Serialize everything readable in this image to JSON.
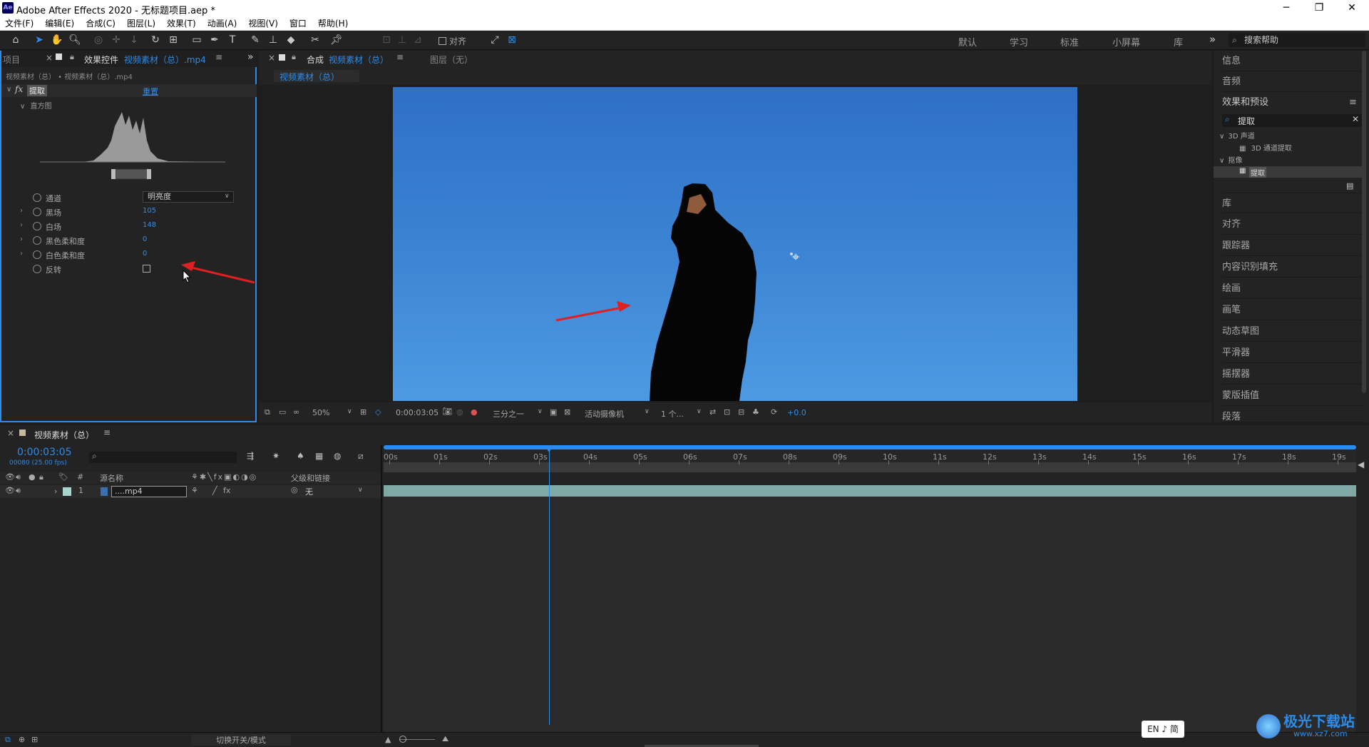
{
  "app": {
    "title": "Adobe After Effects 2020 - 无标题项目.aep *",
    "logo": "Ae"
  },
  "window_controls": {
    "minimize": "─",
    "restore": "❐",
    "close": "✕"
  },
  "menu": [
    "文件(F)",
    "编辑(E)",
    "合成(C)",
    "图层(L)",
    "效果(T)",
    "动画(A)",
    "视图(V)",
    "窗口",
    "帮助(H)"
  ],
  "toolbar": {
    "align_label": "对齐",
    "workspaces": [
      "默认",
      "学习",
      "标准",
      "小屏幕",
      "库"
    ],
    "more": "»",
    "search_help": "搜索帮助"
  },
  "left_panel": {
    "project_tab": "项目",
    "tab_prefix": "效果控件",
    "tab_source": "视频素材（总）.mp4",
    "breadcrumb": "视频素材（总） • 视频素材（总）.mp4",
    "effect_name": "提取",
    "reset": "重置",
    "histogram_label": "直方图",
    "properties": [
      {
        "label": "通道",
        "value": "明亮度",
        "type": "select"
      },
      {
        "label": "黑场",
        "value": "105",
        "type": "num"
      },
      {
        "label": "白场",
        "value": "148",
        "type": "num"
      },
      {
        "label": "黑色柔和度",
        "value": "0",
        "type": "num"
      },
      {
        "label": "白色柔和度",
        "value": "0",
        "type": "num"
      },
      {
        "label": "反转",
        "value": "",
        "type": "checkbox"
      }
    ]
  },
  "comp_panel": {
    "tab_prefix": "合成",
    "tab_name": "视频素材（总）",
    "layer_tab": "图层（无）",
    "sub_tab": "视频素材（总）",
    "zoom": "50%",
    "timecode": "0:00:03:05",
    "resolution": "三分之一",
    "camera": "活动摄像机",
    "views": "1 个...",
    "exposure": "+0.0"
  },
  "right_panel": {
    "info": "信息",
    "audio": "音频",
    "effects_presets": "效果和预设",
    "search_value": "提取",
    "tree": [
      {
        "label": "3D 声道",
        "level": 0
      },
      {
        "label": "3D 通道提取",
        "level": 1
      },
      {
        "label": "抠像",
        "level": 0
      },
      {
        "label": "提取",
        "level": 1,
        "selected": true
      }
    ],
    "items": [
      "库",
      "对齐",
      "跟踪器",
      "内容识别填充",
      "绘画",
      "画笔",
      "动态草图",
      "平滑器",
      "摇摆器",
      "蒙版插值",
      "段落"
    ]
  },
  "timeline": {
    "tab_name": "视频素材（总）",
    "timecode": "0:00:03:05",
    "timecode_sub": "00080 (25.00 fps)",
    "col_source": "源名称",
    "col_parent": "父级和链接",
    "layer_num": "1",
    "layer_name": "....mp4",
    "layer_parent": "无",
    "ruler": [
      "00s",
      "01s",
      "02s",
      "03s",
      "04s",
      "05s",
      "06s",
      "07s",
      "08s",
      "09s",
      "10s",
      "11s",
      "12s",
      "13s",
      "14s",
      "15s",
      "16s",
      "17s",
      "18s",
      "19s"
    ],
    "playhead_seconds": 3.2,
    "footer_toggle": "切换开关/模式"
  },
  "ime": "EN ♪ 简",
  "watermark": {
    "text": "极光下载站",
    "url_text": "www.xz7.com"
  },
  "colors": {
    "accent": "#2d8ceb",
    "panel": "#232323",
    "sky_top": "#2f6fc6",
    "sky_bottom": "#4e9ae2"
  }
}
